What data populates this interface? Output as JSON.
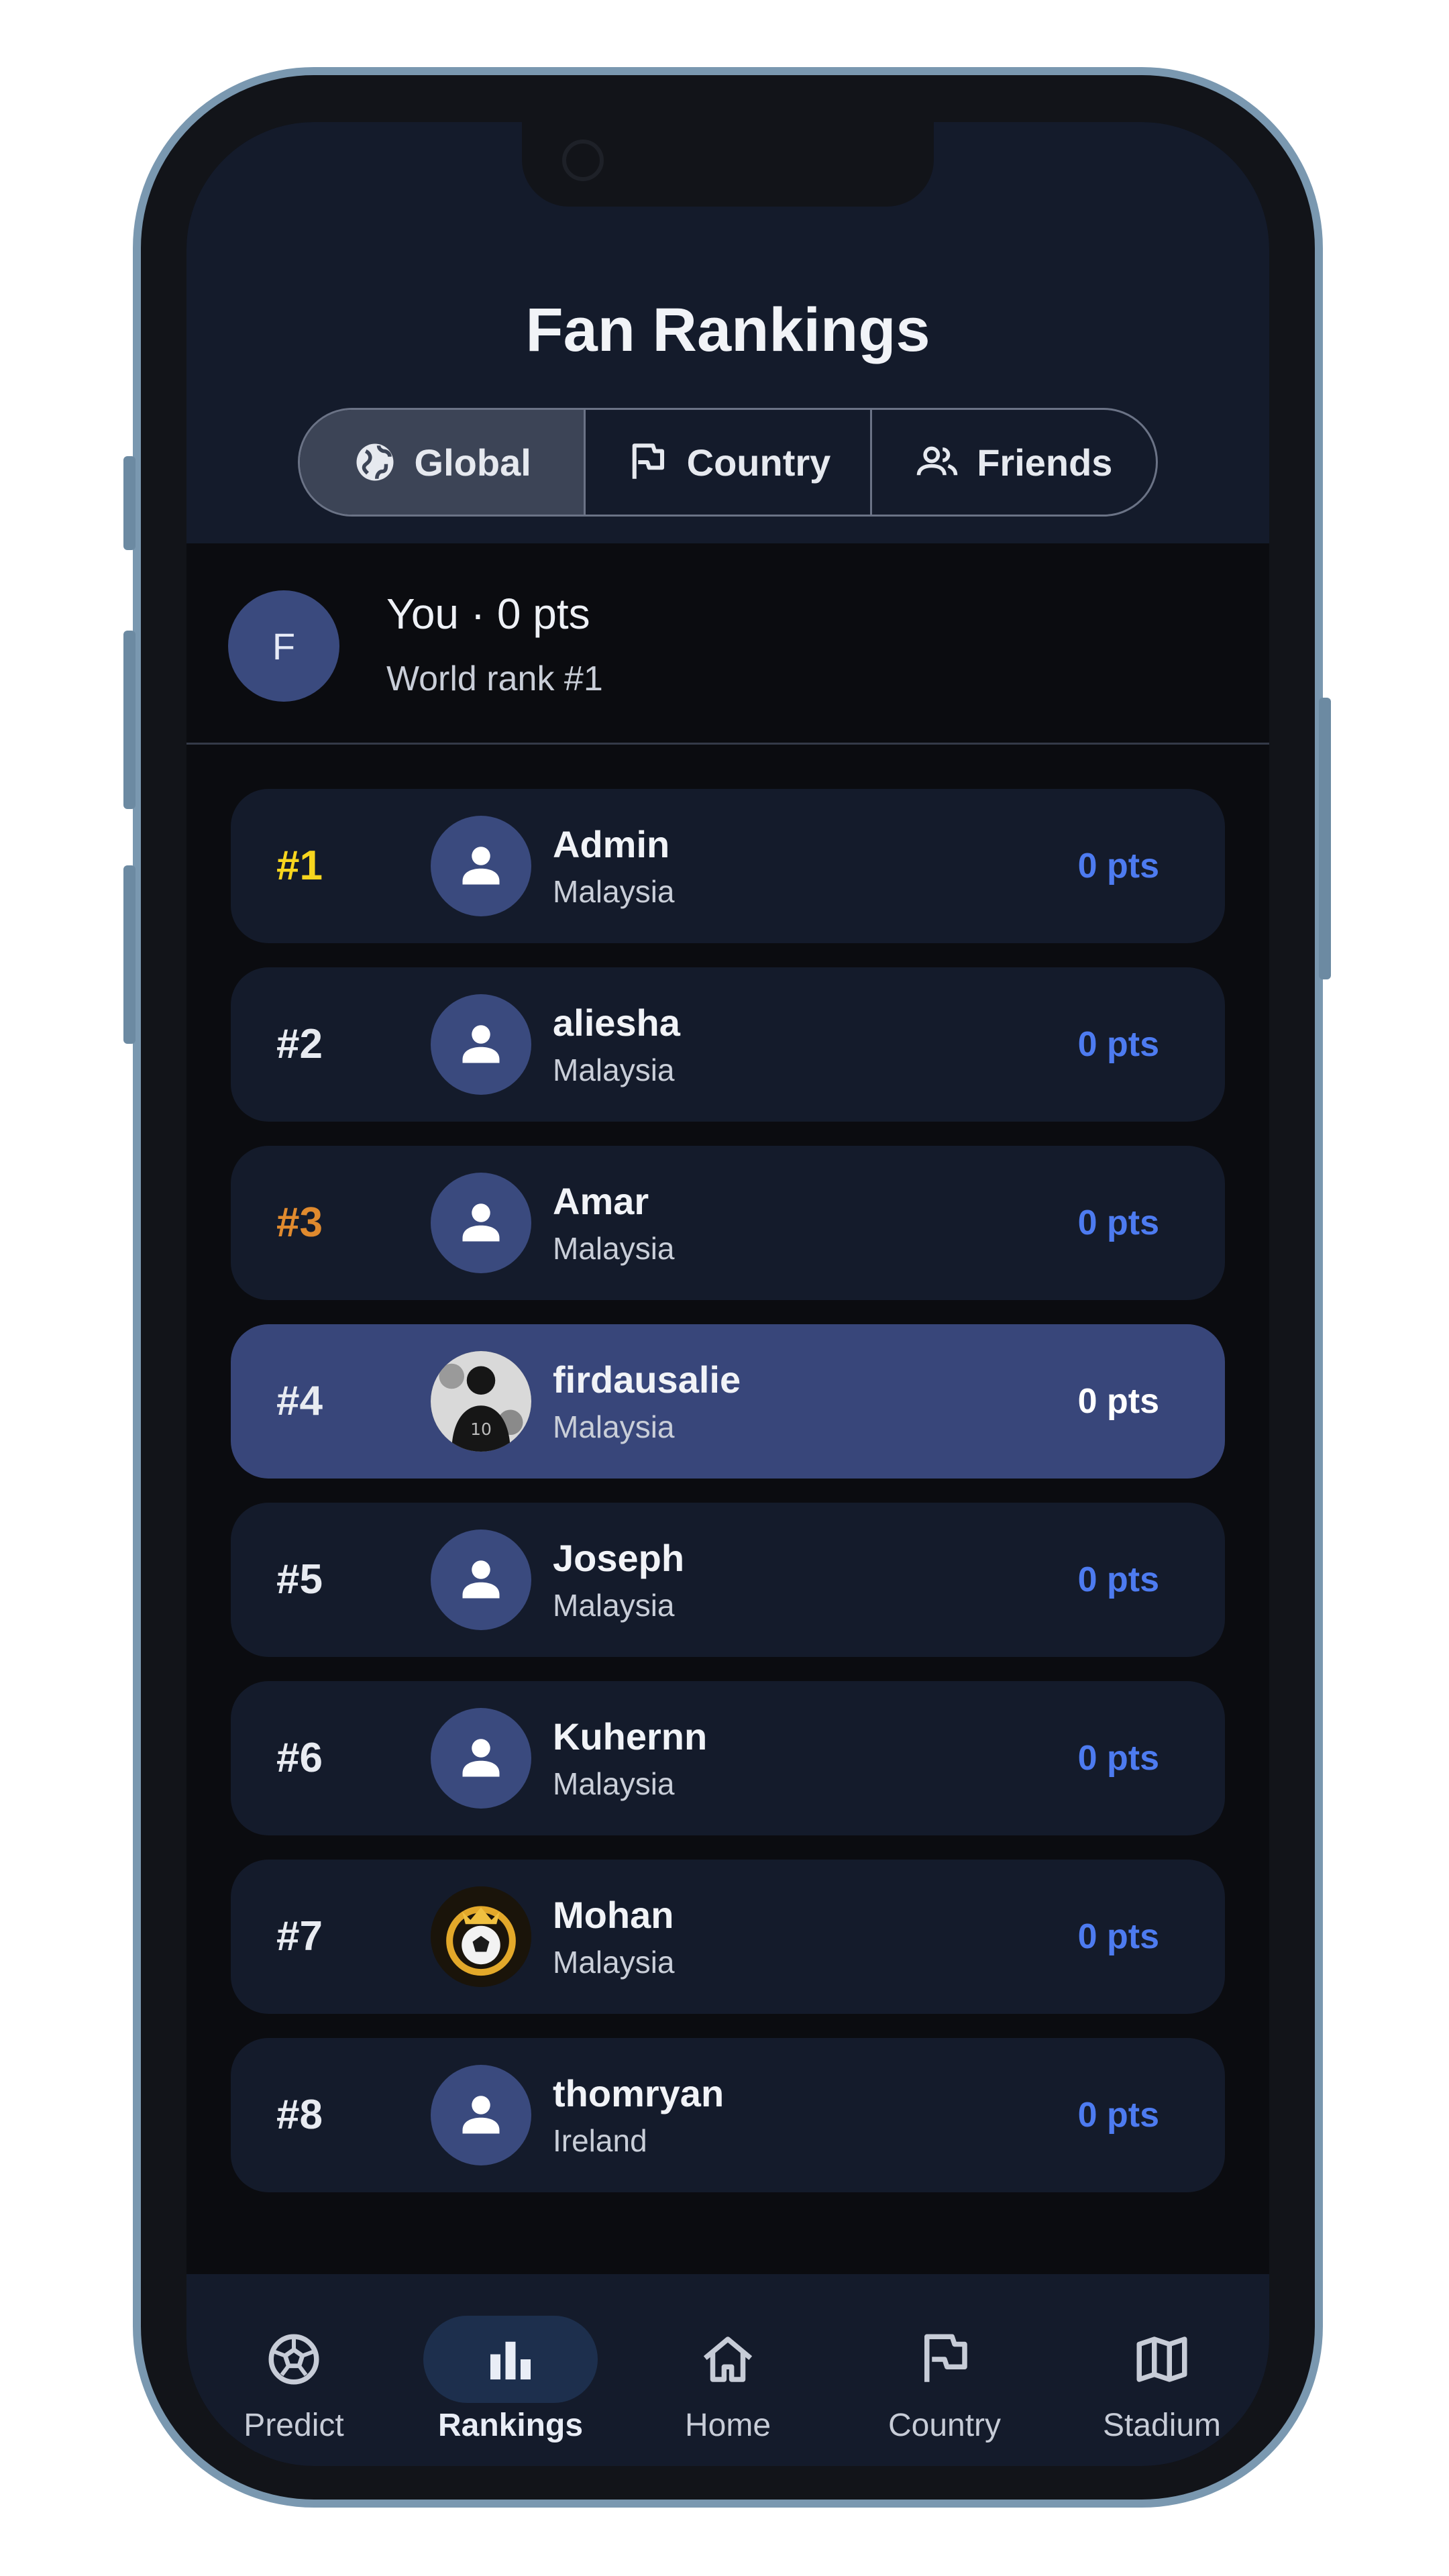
{
  "header": {
    "title": "Fan Rankings"
  },
  "scope_tabs": [
    {
      "label": "Global",
      "icon": "globe-icon",
      "active": true
    },
    {
      "label": "Country",
      "icon": "flag-icon",
      "active": false
    },
    {
      "label": "Friends",
      "icon": "people-icon",
      "active": false
    }
  ],
  "me": {
    "initial": "F",
    "title": "You · 0 pts",
    "subtitle": "World rank #1"
  },
  "rank_colors": {
    "gold": "#f7d51e",
    "bronze": "#e08a2e",
    "default": "#e8ebf1",
    "points": "#4d7bf0",
    "highlight": "#38467a"
  },
  "leaderboard": [
    {
      "rank": "#1",
      "name": "Admin",
      "country": "Malaysia",
      "points": "0 pts",
      "avatar": "person-icon"
    },
    {
      "rank": "#2",
      "name": "aliesha",
      "country": "Malaysia",
      "points": "0 pts",
      "avatar": "person-icon"
    },
    {
      "rank": "#3",
      "name": "Amar",
      "country": "Malaysia",
      "points": "0 pts",
      "avatar": "person-icon"
    },
    {
      "rank": "#4",
      "name": "firdausalie",
      "country": "Malaysia",
      "points": "0 pts",
      "avatar": "player-photo",
      "current_user": true
    },
    {
      "rank": "#5",
      "name": "Joseph",
      "country": "Malaysia",
      "points": "0 pts",
      "avatar": "person-icon"
    },
    {
      "rank": "#6",
      "name": "Kuhernn",
      "country": "Malaysia",
      "points": "0 pts",
      "avatar": "person-icon"
    },
    {
      "rank": "#7",
      "name": "Mohan",
      "country": "Malaysia",
      "points": "0 pts",
      "avatar": "football-crown-photo"
    },
    {
      "rank": "#8",
      "name": "thomryan",
      "country": "Ireland",
      "points": "0 pts",
      "avatar": "person-icon"
    }
  ],
  "bottom_nav": [
    {
      "label": "Predict",
      "icon": "soccer-ball-icon",
      "active": false
    },
    {
      "label": "Rankings",
      "icon": "bar-chart-icon",
      "active": true
    },
    {
      "label": "Home",
      "icon": "home-icon",
      "active": false
    },
    {
      "label": "Country",
      "icon": "flag-icon",
      "active": false
    },
    {
      "label": "Stadium",
      "icon": "map-icon",
      "active": false
    }
  ]
}
